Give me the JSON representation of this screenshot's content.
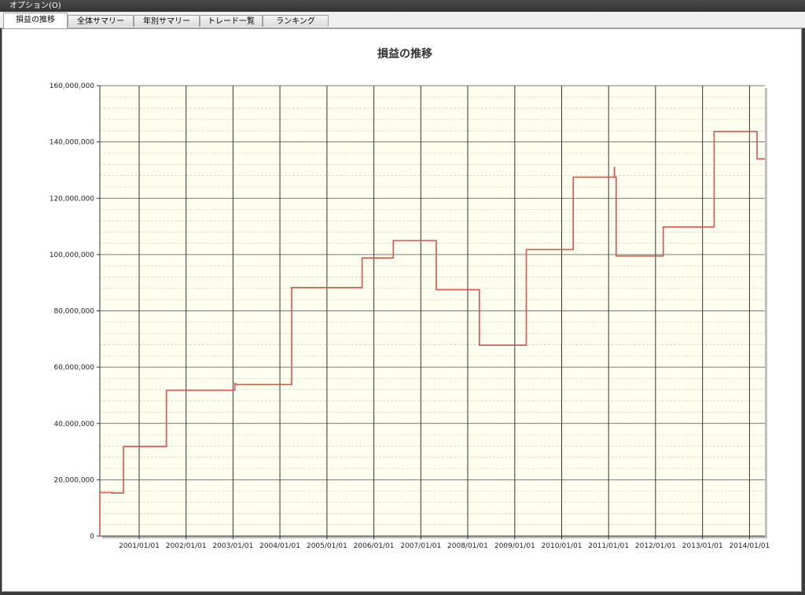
{
  "menu": {
    "options_label": "オプション(O)"
  },
  "tabs": [
    {
      "label": "損益の推移",
      "active": true
    },
    {
      "label": "全体サマリー",
      "active": false
    },
    {
      "label": "年別サマリー",
      "active": false
    },
    {
      "label": "トレード一覧",
      "active": false
    },
    {
      "label": "ランキング",
      "active": false
    }
  ],
  "colors": {
    "plot_bg": "#fffff0",
    "line": "#d9534f"
  },
  "chart_data": {
    "type": "line",
    "step": true,
    "title": "損益の推移",
    "xlabel": "",
    "ylabel": "",
    "ylim": [
      0,
      160000000
    ],
    "yticks": [
      "0",
      "20,000,000",
      "40,000,000",
      "60,000,000",
      "80,000,000",
      "100,000,000",
      "120,000,000",
      "140,000,000",
      "160,000,000"
    ],
    "xticks": [
      "2001/01/01",
      "2002/01/01",
      "2003/01/01",
      "2004/01/01",
      "2005/01/01",
      "2006/01/01",
      "2007/01/01",
      "2008/01/01",
      "2009/01/01",
      "2010/01/01",
      "2011/01/01",
      "2012/01/01",
      "2013/01/01",
      "2014/01/01"
    ],
    "xlim": [
      "2000/03/01",
      "2014/05/01"
    ],
    "grid": true,
    "series": [
      {
        "x": [
          "2000/03/01",
          "2000/03/01",
          "2000/06/01",
          "2000/06/01",
          "2000/09/01",
          "2000/09/01",
          "2001/08/01",
          "2001/08/01",
          "2002/08/01",
          "2002/08/01",
          "2003/01/15",
          "2003/01/15",
          "2003/01/20",
          "2003/01/20",
          "2004/04/01",
          "2004/04/01",
          "2004/09/01",
          "2004/09/01",
          "2005/10/01",
          "2005/10/01",
          "2006/06/01",
          "2006/06/01",
          "2007/05/01",
          "2007/05/01",
          "2008/04/01",
          "2008/04/01",
          "2009/04/01",
          "2009/04/01",
          "2010/04/01",
          "2010/04/01",
          "2011/02/15",
          "2011/02/15",
          "2011/02/16",
          "2011/02/16",
          "2011/03/01",
          "2011/03/01",
          "2012/03/01",
          "2012/03/01",
          "2013/04/01",
          "2013/04/01",
          "2014/03/01",
          "2014/03/01",
          "2014/05/01"
        ],
        "y": [
          0,
          15500000,
          15500000,
          15300000,
          15300000,
          31800000,
          31800000,
          51800000,
          51800000,
          51800000,
          51800000,
          54200000,
          54200000,
          53800000,
          53800000,
          88300000,
          88300000,
          88300000,
          88300000,
          98800000,
          98800000,
          105000000,
          105000000,
          87500000,
          87500000,
          67800000,
          67800000,
          101800000,
          101800000,
          127500000,
          127500000,
          131000000,
          131000000,
          127500000,
          127500000,
          99500000,
          99500000,
          109800000,
          109800000,
          143700000,
          143700000,
          134000000,
          134000000
        ]
      }
    ]
  }
}
